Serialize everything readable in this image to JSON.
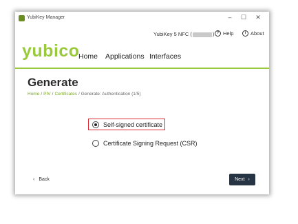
{
  "window": {
    "title": "YubiKey Manager",
    "controls": {
      "minimize": "–",
      "maximize": "☐",
      "close": "✕"
    }
  },
  "device": {
    "name_prefix": "YubiKey 5 NFC (",
    "name_suffix": ")",
    "help_label": "Help",
    "about_label": "About",
    "help_icon": "?",
    "about_icon": "i"
  },
  "header": {
    "logo": "yubico",
    "nav": [
      "Home",
      "Applications",
      "Interfaces"
    ]
  },
  "page": {
    "title": "Generate",
    "breadcrumb": [
      "Home",
      "PIV",
      "Certificates",
      "Generate: Authentication (1/5)"
    ],
    "breadcrumb_sep": "/"
  },
  "options": [
    {
      "label": "Self-signed certificate",
      "selected": true
    },
    {
      "label": "Certificate Signing Request (CSR)",
      "selected": false
    }
  ],
  "footer": {
    "back_label": "Back",
    "back_icon": "‹",
    "next_label": "Next",
    "next_icon": "›"
  },
  "colors": {
    "brand_green": "#9aca3c",
    "highlight_red": "#d9262f",
    "next_bg": "#263444"
  }
}
